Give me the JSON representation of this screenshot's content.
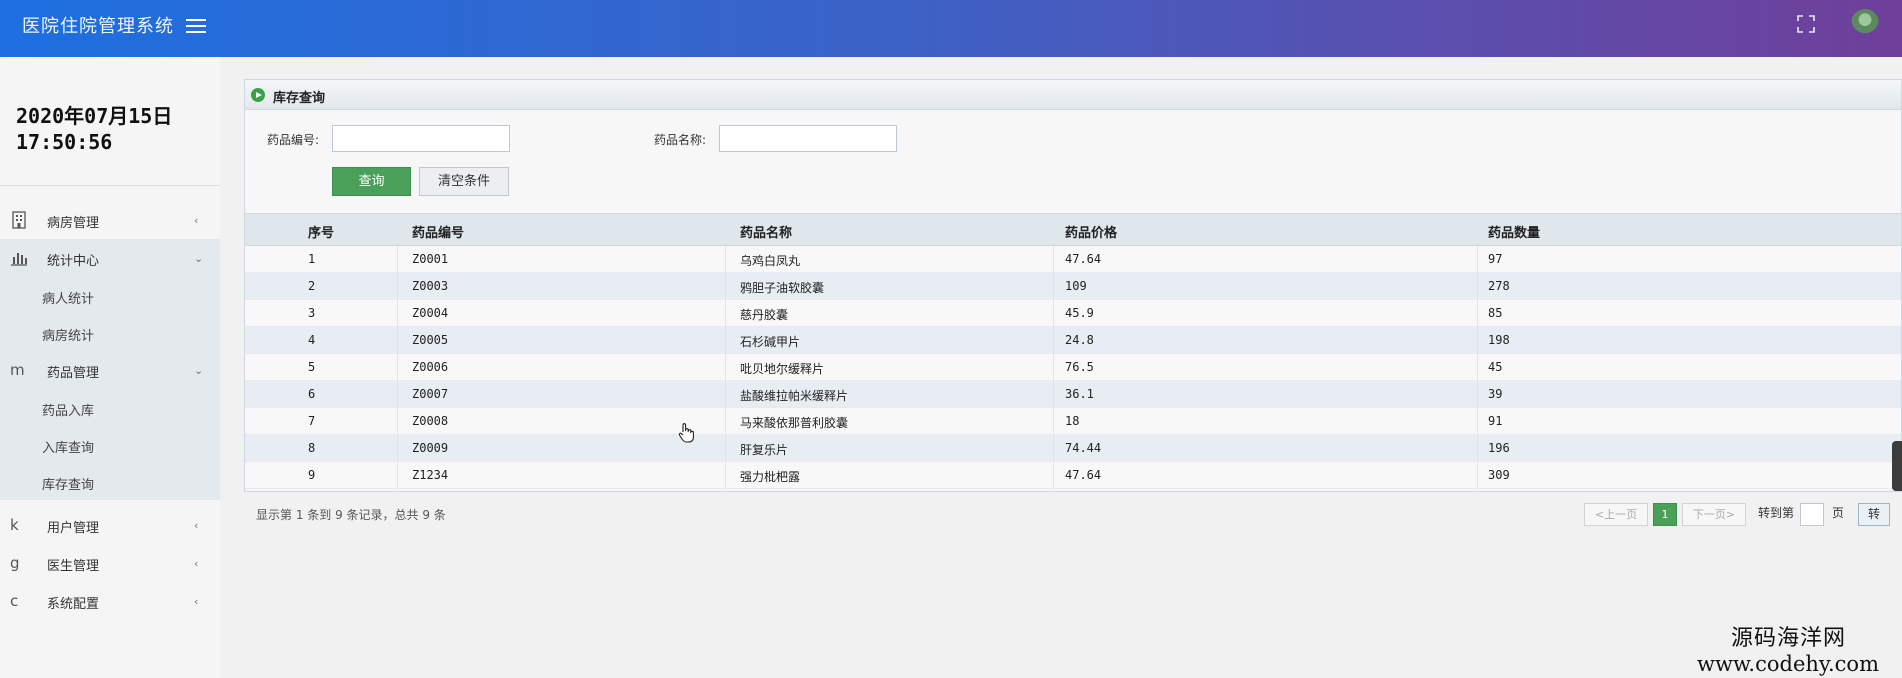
{
  "header": {
    "title": "医院住院管理系统"
  },
  "sidebar": {
    "date": "2020年07月15日",
    "time": "17:50:56",
    "items": [
      {
        "icon": "building-icon",
        "label": "病房管理"
      },
      {
        "icon": "bar-chart-icon",
        "label": "统计中心",
        "children": [
          "病人统计",
          "病房统计"
        ]
      },
      {
        "icon": "m",
        "label": "药品管理",
        "children": [
          "药品入库",
          "入库查询",
          "库存查询"
        ]
      },
      {
        "icon": "k",
        "label": "用户管理"
      },
      {
        "icon": "g",
        "label": "医生管理"
      },
      {
        "icon": "c",
        "label": "系统配置"
      }
    ]
  },
  "panel": {
    "title": "库存查询",
    "form": {
      "code_label": "药品编号:",
      "code_value": "",
      "name_label": "药品名称:",
      "name_value": "",
      "query_button": "查询",
      "clear_button": "清空条件"
    }
  },
  "table": {
    "columns": [
      "序号",
      "药品编号",
      "药品名称",
      "药品价格",
      "药品数量"
    ],
    "rows": [
      [
        "1",
        "Z0001",
        "乌鸡白凤丸",
        "47.64",
        "97"
      ],
      [
        "2",
        "Z0003",
        "鸦胆子油软胶囊",
        "109",
        "278"
      ],
      [
        "3",
        "Z0004",
        "慈丹胶囊",
        "45.9",
        "85"
      ],
      [
        "4",
        "Z0005",
        "石杉碱甲片",
        "24.8",
        "198"
      ],
      [
        "5",
        "Z0006",
        "吡贝地尔缓释片",
        "76.5",
        "45"
      ],
      [
        "6",
        "Z0007",
        "盐酸维拉帕米缓释片",
        "36.1",
        "39"
      ],
      [
        "7",
        "Z0008",
        "马来酸依那普利胶囊",
        "18",
        "91"
      ],
      [
        "8",
        "Z0009",
        "肝复乐片",
        "74.44",
        "196"
      ],
      [
        "9",
        "Z1234",
        "强力枇杷露",
        "47.64",
        "309"
      ]
    ]
  },
  "pagination": {
    "info": "显示第 1 条到 9 条记录，总共 9 条",
    "prev": "<上一页",
    "current": "1",
    "next": "下一页>",
    "goto_prefix": "转到第",
    "goto_value": "",
    "goto_suffix": "页",
    "goto_button": "转"
  },
  "watermark": {
    "line1": "源码海洋网",
    "line2": "www.codehy.com"
  }
}
